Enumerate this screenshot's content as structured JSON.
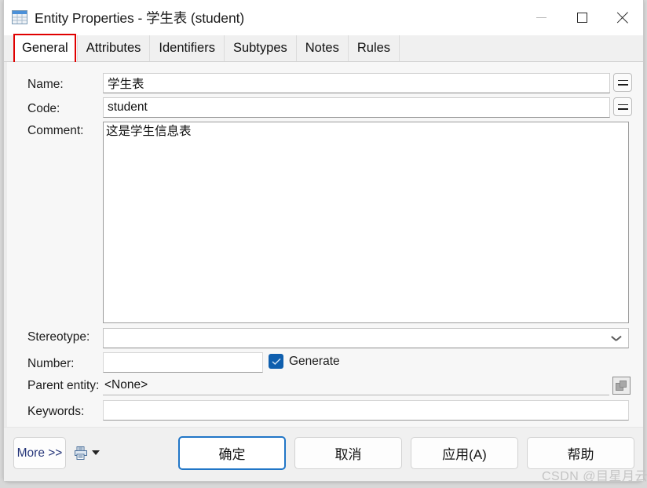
{
  "window": {
    "title": "Entity Properties - 学生表 (student)",
    "icon": "table-icon",
    "controls": {
      "minimize": "minimize-icon",
      "maximize": "maximize-icon",
      "close": "close-icon"
    }
  },
  "tabs": [
    {
      "label": "General",
      "active": true,
      "highlighted": true
    },
    {
      "label": "Attributes",
      "active": false,
      "highlighted": false
    },
    {
      "label": "Identifiers",
      "active": false,
      "highlighted": false
    },
    {
      "label": "Subtypes",
      "active": false,
      "highlighted": false
    },
    {
      "label": "Notes",
      "active": false,
      "highlighted": false
    },
    {
      "label": "Rules",
      "active": false,
      "highlighted": false
    }
  ],
  "form": {
    "name": {
      "label": "Name:",
      "value": "学生表",
      "button": "="
    },
    "code": {
      "label": "Code:",
      "value": "student",
      "button": "="
    },
    "comment": {
      "label": "Comment:",
      "value": "这是学生信息表"
    },
    "stereotype": {
      "label": "Stereotype:",
      "value": "",
      "placeholder": ""
    },
    "number": {
      "label": "Number:",
      "value": "",
      "placeholder": ""
    },
    "generate": {
      "label": "Generate",
      "checked": true
    },
    "parent_entity": {
      "label": "Parent entity:",
      "value": "<None>"
    },
    "keywords": {
      "label": "Keywords:",
      "value": "",
      "placeholder": ""
    }
  },
  "footer": {
    "more": "More >>",
    "print_icon": "print-icon",
    "dropdown_caret": "chevron-down-icon",
    "ok": "确定",
    "cancel": "取消",
    "apply": "应用(A)",
    "help": "帮助"
  },
  "watermark": "CSDN @目星月云",
  "colors": {
    "accent_blue": "#0f5fae",
    "default_button_border": "#2176c7",
    "highlight_red": "#e00000",
    "title_icon_blue": "#4a90d9",
    "window_bg": "#f3f3f3",
    "client_bg": "#f7f7f7"
  }
}
